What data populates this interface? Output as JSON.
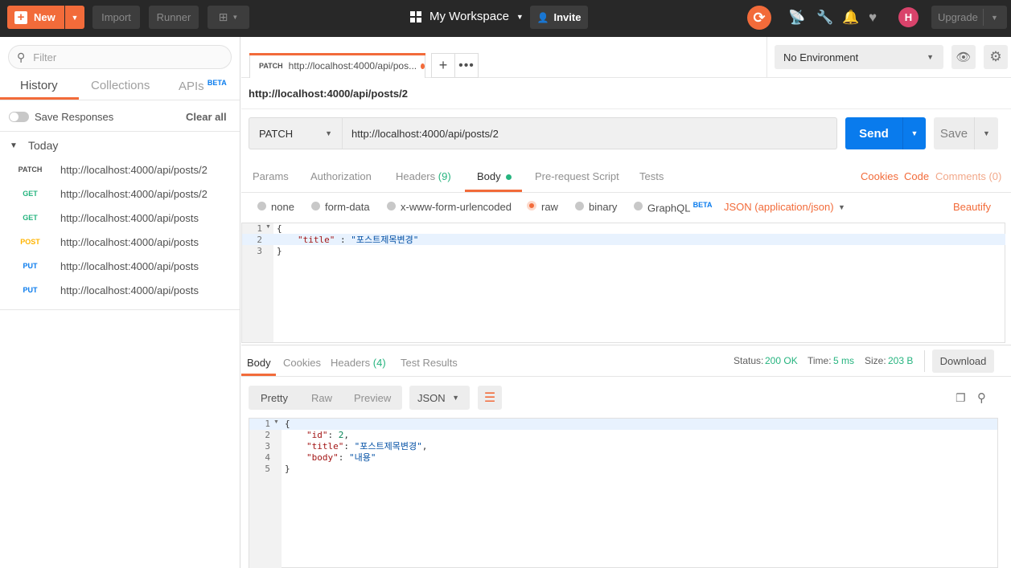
{
  "topbar": {
    "new_label": "New",
    "import_label": "Import",
    "runner_label": "Runner",
    "workspace_label": "My Workspace",
    "invite_label": "Invite",
    "upgrade_label": "Upgrade",
    "avatar_initial": "H",
    "accent": "#f26b3a"
  },
  "sidebar": {
    "filter_placeholder": "Filter",
    "tabs": {
      "history": "History",
      "collections": "Collections",
      "apis": "APIs",
      "apis_badge": "BETA"
    },
    "save_responses": "Save Responses",
    "clear_all": "Clear all",
    "group_label": "Today",
    "history": [
      {
        "method": "PATCH",
        "url": "http://localhost:4000/api/posts/2",
        "color": "#505050"
      },
      {
        "method": "GET",
        "url": "http://localhost:4000/api/posts/2",
        "color": "#26b47f"
      },
      {
        "method": "GET",
        "url": "http://localhost:4000/api/posts",
        "color": "#26b47f"
      },
      {
        "method": "POST",
        "url": "http://localhost:4000/api/posts",
        "color": "#ffb400"
      },
      {
        "method": "PUT",
        "url": "http://localhost:4000/api/posts",
        "color": "#097bed"
      },
      {
        "method": "PUT",
        "url": "http://localhost:4000/api/posts",
        "color": "#097bed"
      }
    ]
  },
  "request_tab": {
    "method": "PATCH",
    "label": "http://localhost:4000/api/pos..."
  },
  "environment": {
    "selected": "No Environment"
  },
  "request": {
    "title": "http://localhost:4000/api/posts/2",
    "method": "PATCH",
    "url": "http://localhost:4000/api/posts/2",
    "send_label": "Send",
    "save_label": "Save",
    "tabs": {
      "params": "Params",
      "authorization": "Authorization",
      "headers": "Headers",
      "headers_count": "(9)",
      "body": "Body",
      "prerequest": "Pre-request Script",
      "tests": "Tests"
    },
    "links": {
      "cookies": "Cookies",
      "code": "Code",
      "comments": "Comments (0)"
    },
    "body_types": {
      "none": "none",
      "form_data": "form-data",
      "urlencoded": "x-www-form-urlencoded",
      "raw": "raw",
      "binary": "binary",
      "graphql": "GraphQL",
      "graphql_badge": "BETA",
      "selected": "raw"
    },
    "content_type": "JSON (application/json)",
    "beautify": "Beautify",
    "body_lines": {
      "l1": "{",
      "l2_key": "\"title\"",
      "l2_sep": " : ",
      "l2_val": "\"포스트제목변경\"",
      "l3": "}"
    }
  },
  "response": {
    "tabs": {
      "body": "Body",
      "cookies": "Cookies",
      "headers": "Headers",
      "headers_count": "(4)",
      "test_results": "Test Results"
    },
    "status_label": "Status:",
    "status_value": "200 OK",
    "time_label": "Time:",
    "time_value": "5 ms",
    "size_label": "Size:",
    "size_value": "203 B",
    "download_label": "Download",
    "views": {
      "pretty": "Pretty",
      "raw": "Raw",
      "preview": "Preview"
    },
    "format": "JSON",
    "body_lines": {
      "l1": "{",
      "l2_key": "\"id\"",
      "l2_val": "2",
      "l3_key": "\"title\"",
      "l3_val": "\"포스트제목변경\"",
      "l4_key": "\"body\"",
      "l4_val": "\"내용\"",
      "l5": "}"
    }
  }
}
